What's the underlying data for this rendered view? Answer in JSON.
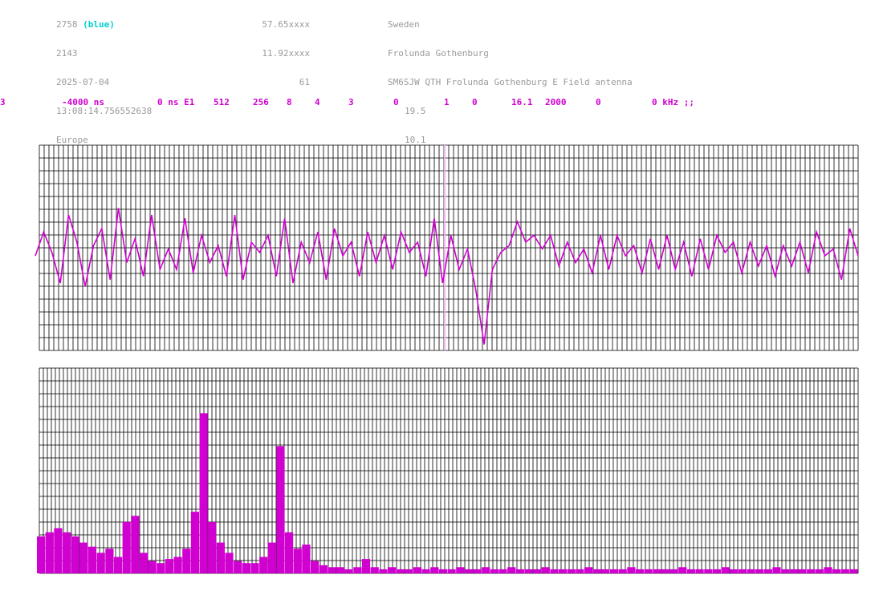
{
  "header": {
    "col1": {
      "station_id": "2758",
      "color_tag": "(blue)",
      "number": "2143",
      "date": "2025-07-04",
      "time": "13:08:14.756552638",
      "region": "Europe"
    },
    "col2": {
      "lat": "57.65xxxx",
      "lon": "11.92xxxx",
      "value": "61"
    },
    "col3": {
      "country": "Sweden",
      "city": "Frolunda Gothenburg",
      "description": "SM6SJW QTH Frolunda Gothenburg E Field antenna",
      "value1": "19.5",
      "value2": "10.1"
    }
  },
  "params": {
    "p1": "3",
    "p2": "-4000 ns",
    "p3": "0 ns E1",
    "p4": "512",
    "p5": "256",
    "p6": "8",
    "p7": "4",
    "p8": "3",
    "p9": "0",
    "p10": "1",
    "p11": "0",
    "p12": "16.1",
    "p13": "2000",
    "p14": "0",
    "p15": "0 kHz ;;"
  },
  "colors": {
    "trace": "#d000d0",
    "grid": "#000000",
    "text": "#9a9a9a",
    "accent": "#00d0d0",
    "marker": "#f0b0f0"
  },
  "chart_data": [
    {
      "type": "line",
      "marker_at": 0.495,
      "y": [
        0.0,
        0.35,
        0.05,
        -0.4,
        0.6,
        0.2,
        -0.45,
        0.15,
        0.4,
        -0.35,
        0.7,
        -0.1,
        0.25,
        -0.3,
        0.6,
        -0.2,
        0.1,
        -0.2,
        0.55,
        -0.25,
        0.3,
        -0.1,
        0.15,
        -0.3,
        0.6,
        -0.35,
        0.2,
        0.05,
        0.3,
        -0.3,
        0.55,
        -0.4,
        0.2,
        -0.1,
        0.35,
        -0.35,
        0.4,
        0.0,
        0.2,
        -0.3,
        0.35,
        -0.1,
        0.3,
        -0.2,
        0.35,
        0.05,
        0.2,
        -0.3,
        0.55,
        -0.4,
        0.3,
        -0.2,
        0.1,
        -0.5,
        -1.3,
        -0.2,
        0.05,
        0.15,
        0.5,
        0.2,
        0.3,
        0.1,
        0.3,
        -0.15,
        0.2,
        -0.1,
        0.1,
        -0.25,
        0.3,
        -0.2,
        0.3,
        0.0,
        0.15,
        -0.25,
        0.25,
        -0.2,
        0.3,
        -0.2,
        0.2,
        -0.3,
        0.25,
        -0.2,
        0.3,
        0.05,
        0.2,
        -0.25,
        0.2,
        -0.15,
        0.15,
        -0.3,
        0.15,
        -0.15,
        0.2,
        -0.25,
        0.35,
        0.0,
        0.1,
        -0.35,
        0.4,
        0.0
      ]
    },
    {
      "type": "bar",
      "values": [
        0.18,
        0.2,
        0.22,
        0.2,
        0.18,
        0.15,
        0.13,
        0.1,
        0.12,
        0.08,
        0.25,
        0.28,
        0.1,
        0.06,
        0.05,
        0.07,
        0.08,
        0.12,
        0.3,
        0.78,
        0.25,
        0.15,
        0.1,
        0.06,
        0.05,
        0.05,
        0.08,
        0.15,
        0.62,
        0.2,
        0.12,
        0.14,
        0.06,
        0.04,
        0.03,
        0.03,
        0.02,
        0.03,
        0.07,
        0.03,
        0.02,
        0.03,
        0.02,
        0.02,
        0.03,
        0.02,
        0.03,
        0.02,
        0.02,
        0.03,
        0.02,
        0.02,
        0.03,
        0.02,
        0.02,
        0.03,
        0.02,
        0.02,
        0.02,
        0.03,
        0.02,
        0.02,
        0.02,
        0.02,
        0.03,
        0.02,
        0.02,
        0.02,
        0.02,
        0.03,
        0.02,
        0.02,
        0.02,
        0.02,
        0.02,
        0.03,
        0.02,
        0.02,
        0.02,
        0.02,
        0.03,
        0.02,
        0.02,
        0.02,
        0.02,
        0.02,
        0.03,
        0.02,
        0.02,
        0.02,
        0.02,
        0.02,
        0.03,
        0.02,
        0.02,
        0.02
      ]
    }
  ]
}
